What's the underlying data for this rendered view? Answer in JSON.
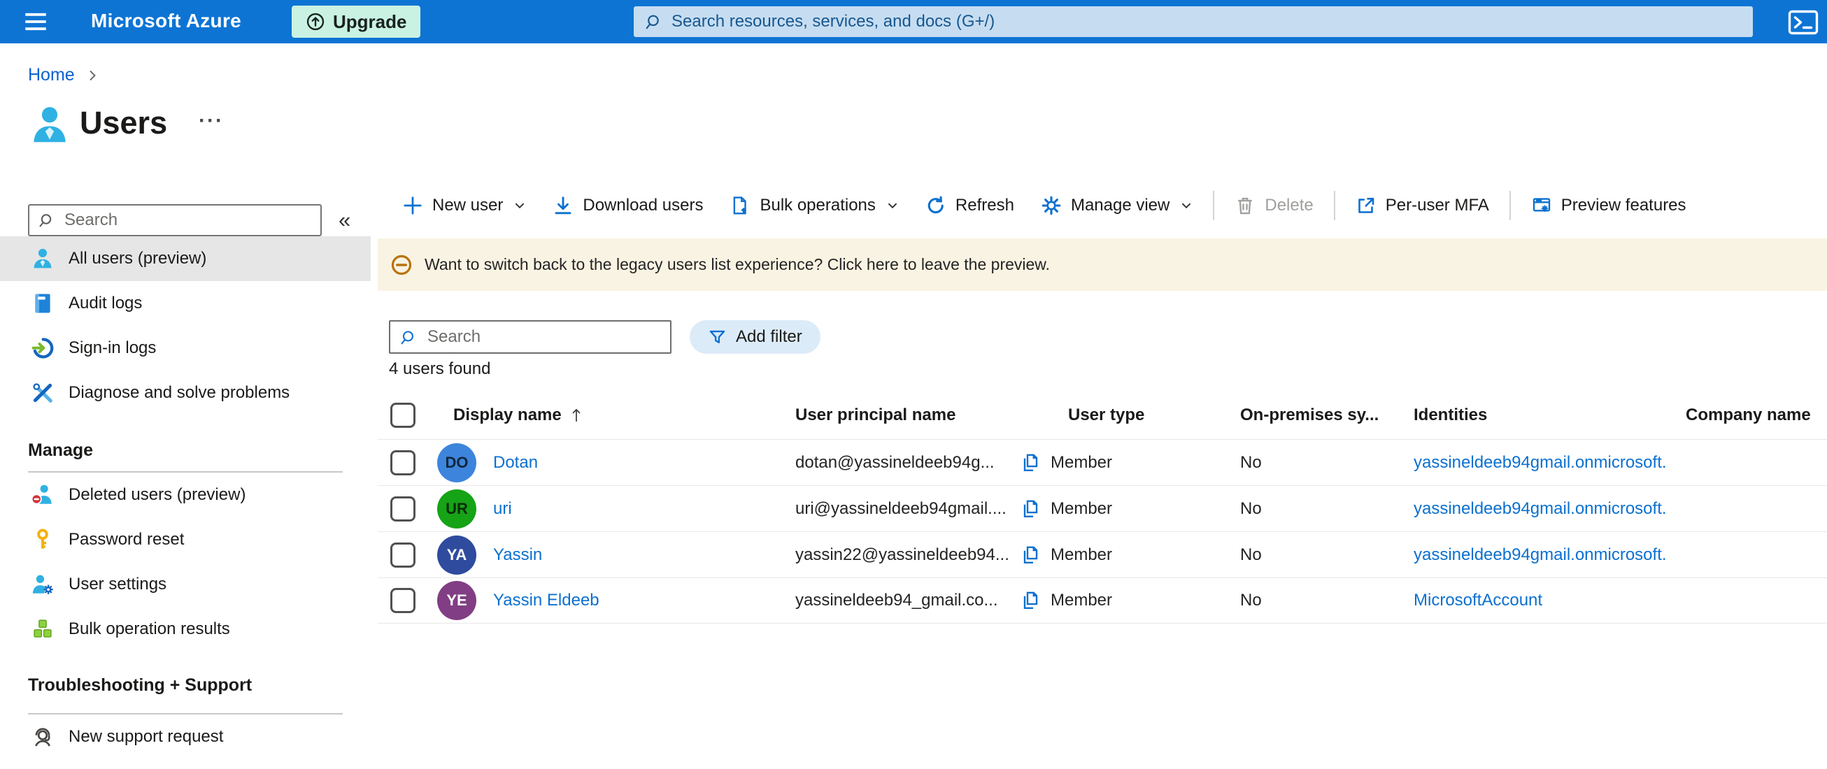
{
  "topbar": {
    "brand": "Microsoft Azure",
    "upgrade_label": "Upgrade",
    "search_placeholder": "Search resources, services, and docs (G+/)"
  },
  "breadcrumb": {
    "home": "Home"
  },
  "page": {
    "title": "Users",
    "context_menu_glyph": "···"
  },
  "sidebar": {
    "search_placeholder": "Search",
    "collapse_glyph": "«",
    "items": [
      {
        "label": "All users (preview)",
        "icon": "person",
        "selected": true
      },
      {
        "label": "Audit logs",
        "icon": "book",
        "selected": false
      },
      {
        "label": "Sign-in logs",
        "icon": "signin",
        "selected": false
      },
      {
        "label": "Diagnose and solve problems",
        "icon": "tools",
        "selected": false
      }
    ],
    "sections": [
      {
        "heading": "Manage",
        "items": [
          {
            "label": "Deleted users (preview)",
            "icon": "person-minus"
          },
          {
            "label": "Password reset",
            "icon": "key"
          },
          {
            "label": "User settings",
            "icon": "person-gear"
          },
          {
            "label": "Bulk operation results",
            "icon": "cubes"
          }
        ]
      },
      {
        "heading": "Troubleshooting + Support",
        "items": [
          {
            "label": "New support request",
            "icon": "headset"
          }
        ]
      }
    ]
  },
  "toolbar": {
    "items": [
      {
        "label": "New user",
        "icon": "plus",
        "dropdown": true
      },
      {
        "label": "Download users",
        "icon": "download"
      },
      {
        "label": "Bulk operations",
        "icon": "bulk-doc",
        "dropdown": true
      },
      {
        "label": "Refresh",
        "icon": "refresh"
      },
      {
        "label": "Manage view",
        "icon": "gear",
        "dropdown": true
      },
      {
        "separator": true
      },
      {
        "label": "Delete",
        "icon": "trash",
        "disabled": true
      },
      {
        "separator": true
      },
      {
        "label": "Per-user MFA",
        "icon": "external-link"
      },
      {
        "separator": true
      },
      {
        "label": "Preview features",
        "icon": "preview-window"
      }
    ]
  },
  "banner": {
    "text": "Want to switch back to the legacy users list experience? Click here to leave the preview."
  },
  "filters": {
    "search_placeholder": "Search",
    "add_filter_label": "Add filter"
  },
  "results_count": "4 users found",
  "table": {
    "columns": [
      {
        "label": "Display name",
        "sorted": "asc"
      },
      {
        "label": "User principal name"
      },
      {
        "label": "User type"
      },
      {
        "label": "On-premises sy..."
      },
      {
        "label": "Identities"
      },
      {
        "label": "Company name"
      }
    ],
    "rows": [
      {
        "initials": "DO",
        "avatar_color": "#3d85dc",
        "initials_color": "#10263d",
        "display_name": "Dotan",
        "upn": "dotan@yassineldeeb94g...",
        "user_type": "Member",
        "on_premises_sync": "No",
        "identity": "yassineldeeb94gmail.onmicrosoft.",
        "company": ""
      },
      {
        "initials": "UR",
        "avatar_color": "#16a316",
        "initials_color": "#0c2b0c",
        "display_name": "uri",
        "upn": "uri@yassineldeeb94gmail....",
        "user_type": "Member",
        "on_premises_sync": "No",
        "identity": "yassineldeeb94gmail.onmicrosoft.",
        "company": ""
      },
      {
        "initials": "YA",
        "avatar_color": "#2f4b9e",
        "initials_color": "#ffffff",
        "display_name": "Yassin",
        "upn": "yassin22@yassineldeeb94...",
        "user_type": "Member",
        "on_premises_sync": "No",
        "identity": "yassineldeeb94gmail.onmicrosoft.",
        "company": ""
      },
      {
        "initials": "YE",
        "avatar_color": "#813e84",
        "initials_color": "#ffffff",
        "display_name": "Yassin Eldeeb",
        "upn": "yassineldeeb94_gmail.co...",
        "user_type": "Member",
        "on_premises_sync": "No",
        "identity": "MicrosoftAccount",
        "company": ""
      }
    ]
  },
  "colors": {
    "topbar_blue": "#0d74d4",
    "accent_blue": "#0c70cf",
    "upgrade_bg": "#c9f2e3",
    "banner_bg": "#f9f3e3",
    "banner_icon_orange": "#b8730c",
    "selected_item_bg": "#e6e6e6"
  }
}
